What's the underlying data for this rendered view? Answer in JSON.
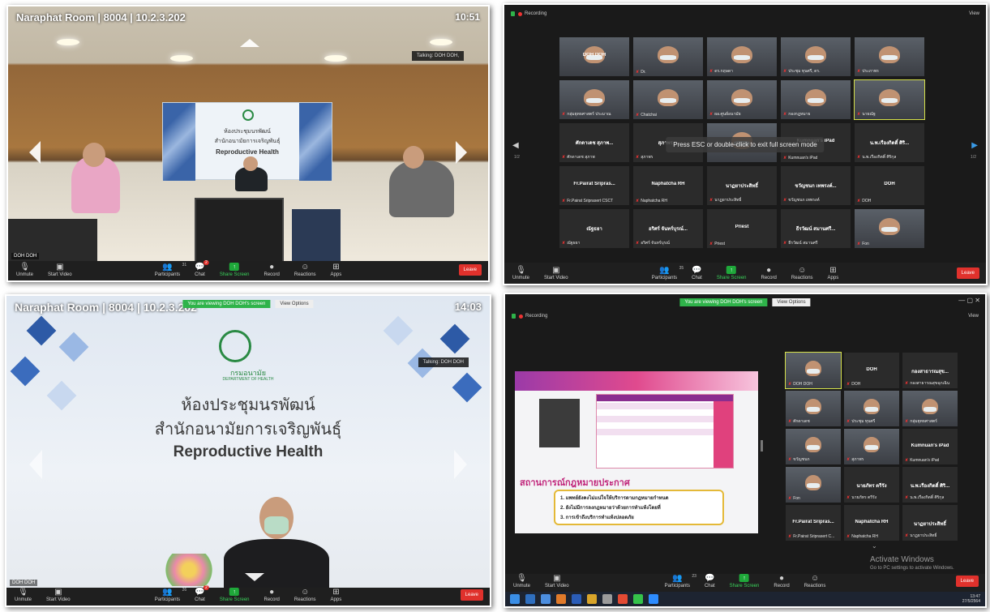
{
  "toolbar": {
    "unmute": "Unmute",
    "start_video": "Start Video",
    "participants": "Participants",
    "chat": "Chat",
    "share_screen": "Share Screen",
    "record": "Record",
    "reactions": "Reactions",
    "apps": "Apps",
    "leave": "Leave"
  },
  "q1": {
    "overlay_title": "Naraphat Room | 8004 | 10.2.3.202",
    "clock": "10:51",
    "talking": "Talking: DOH DOH,",
    "self_tag": "DOH DOH",
    "room_sign": [
      "ห้องประชุมนรพัฒน์",
      "สำนักอนามัยการเจริญพันธุ์",
      "Reproductive Health"
    ],
    "participants_count": "31",
    "chat_badge": "2"
  },
  "q2": {
    "recording": "Recording",
    "view": "View",
    "esc_notice": "Press ESC or double-click to exit full screen mode",
    "page_left": "1/2",
    "page_right": "1/2",
    "participants_count": "35",
    "tiles": [
      {
        "label": "DOH DOH",
        "name_text": "",
        "video": true
      },
      {
        "label": "",
        "name_text": "Dr.",
        "video": true
      },
      {
        "label": "",
        "name_text": "ดร.กฤษดา",
        "video": true
      },
      {
        "label": "",
        "name_text": "ประชุม ทุนศรี, ดร.",
        "video": true
      },
      {
        "label": "",
        "name_text": "ประภาพร",
        "video": true
      },
      {
        "label": "",
        "name_text": "กลุ่มยุทธศาสตร์ ประมาณ",
        "video": true
      },
      {
        "label": "",
        "name_text": "Chatchai",
        "video": true
      },
      {
        "label": "",
        "name_text": "ผอ.ศูนย์อนามัย",
        "video": true
      },
      {
        "label": "",
        "name_text": "กองกฎหมาย",
        "video": true
      },
      {
        "label": "",
        "name_text": "นายณัฐ",
        "video": true
      },
      {
        "label": "ศักดาเดช สุภาพ...",
        "name_text": "ศักดาเดช สุภาพ",
        "video": false
      },
      {
        "label": "สุภาพร ...",
        "name_text": "สุภาพร",
        "video": false
      },
      {
        "label": "",
        "name_text": "",
        "video": true
      },
      {
        "label": "Kumnuan's iPad",
        "name_text": "Kumnuan's iPad",
        "video": false
      },
      {
        "label": "น.พ.เรืองกิตติ์ ศิริ...",
        "name_text": "น.พ.เรืองกิตติ์ ศิริกุล",
        "video": false
      },
      {
        "label": "Fr.Pairat Sripras...",
        "name_text": "Fr.Pairat Sriprasert CSCT",
        "video": false
      },
      {
        "label": "Naphatcha RH",
        "name_text": "Naphatcha RH",
        "video": false
      },
      {
        "label": "นาฏยาประสิทธิ์",
        "name_text": "นาฏยาประสิทธิ์",
        "video": false
      },
      {
        "label": "ขวัญชนก เทพรงค์...",
        "name_text": "ขวัญชนก เทพรงค์",
        "video": false
      },
      {
        "label": "DOH",
        "name_text": "DOH",
        "video": false
      },
      {
        "label": "ณัฐธยา",
        "name_text": "ณัฐธยา",
        "video": false
      },
      {
        "label": "อริศร์ จันทร์บุรณ์...",
        "name_text": "อริศร์ จันทร์บุรณ์",
        "video": false
      },
      {
        "label": "Priest",
        "name_text": "Priest",
        "video": false
      },
      {
        "label": "ธีรวัฒน์ สมานศรี...",
        "name_text": "ธีรวัฒน์ สมานศรี",
        "video": false
      },
      {
        "label": "",
        "name_text": "Fon",
        "video": true
      }
    ]
  },
  "q3": {
    "overlay_title": "Naraphat Room | 8004 | 10.2.3.202",
    "clock": "14:03",
    "viewing": "You are viewing DOH DOH's screen",
    "view_options": "View Options",
    "talking": "Talking: DOH DOH",
    "dept_name": "กรมอนามัย",
    "dept_en": "DEPARTMENT OF HEALTH",
    "sign_line1": "ห้องประชุมนรพัฒน์",
    "sign_line2": "สำนักอนามัยการเจริญพันธุ์",
    "sign_line3": "Reproductive Health",
    "self_tag": "DOH DOH",
    "participants_count": "26",
    "chat_badge": "2"
  },
  "q4": {
    "recording": "Recording",
    "view": "View",
    "viewing": "You are viewing DOH DOH's screen",
    "view_options": "View Options",
    "participants_count": "23",
    "slide_heading": "สถานการณ์กฎหมายประกาศ",
    "slide_points": [
      "1. แพทย์ยังคงไม่แน่ใจให้บริการตามกฎหมายกำหนด",
      "2. ยังไม่มีการลงกฎหมายว่าด้วยการทำแท้งโดยที่",
      "3. การเข้าถึงบริการทำแท้งปลอดภัย"
    ],
    "tiles": [
      {
        "label": "",
        "name_text": "DOH DOH",
        "video": true
      },
      {
        "label": "DOH",
        "name_text": "DOH",
        "video": false
      },
      {
        "label": "กองสาธารณสุข...",
        "name_text": "กองสาธารณสุขฉุกเฉิน",
        "video": false
      },
      {
        "label": "",
        "name_text": "ศักดาเดช",
        "video": true
      },
      {
        "label": "",
        "name_text": "ประชุม ทุนศรี",
        "video": true
      },
      {
        "label": "",
        "name_text": "กลุ่มยุทธศาสตร์",
        "video": true
      },
      {
        "label": "",
        "name_text": "ขวัญชนก",
        "video": true
      },
      {
        "label": "",
        "name_text": "สุภาพร",
        "video": true
      },
      {
        "label": "Kumnuan's iPad",
        "name_text": "Kumnuan's iPad",
        "video": false
      },
      {
        "label": "",
        "name_text": "Fon",
        "video": true
      },
      {
        "label": "นายภัทร ตรีรัง",
        "name_text": "นายภัทร ตรีรัง",
        "video": false
      },
      {
        "label": "น.พ.เรืองกิตติ์ ศิริ...",
        "name_text": "น.พ.เรืองกิตติ์ ศิริกุล",
        "video": false
      },
      {
        "label": "Fr.Pairat Sripras...",
        "name_text": "Fr.Pairat Sriprasert C...",
        "video": false
      },
      {
        "label": "Naphatcha RH",
        "name_text": "Naphatcha RH",
        "video": false
      },
      {
        "label": "นาฏยาประสิทธิ์",
        "name_text": "นาฏยาประสิทธิ์",
        "video": false
      }
    ],
    "activate_title": "Activate Windows",
    "activate_sub": "Go to PC settings to activate Windows.",
    "time": "13:47",
    "date": "27/5/2564"
  }
}
